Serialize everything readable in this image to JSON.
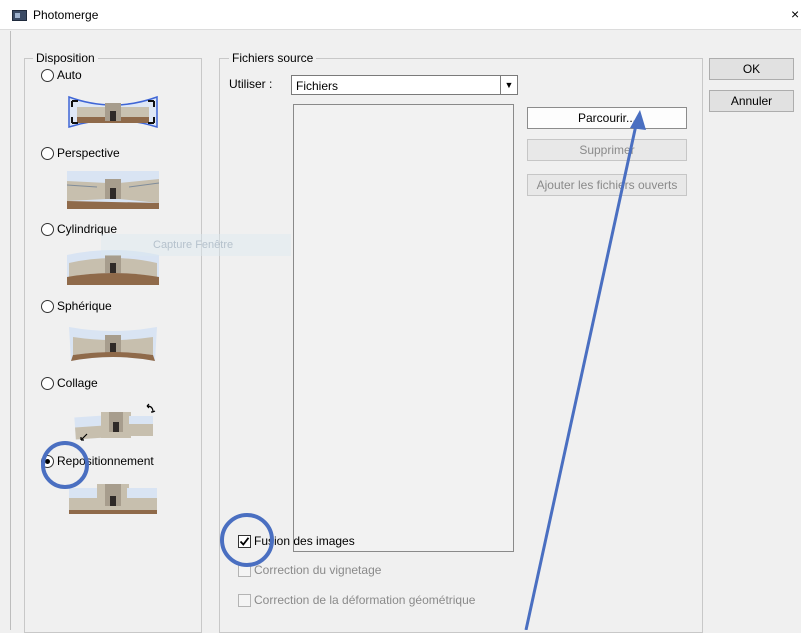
{
  "window": {
    "title": "Photomerge",
    "close_glyph": "×"
  },
  "layout_group": {
    "legend": "Disposition",
    "options": [
      {
        "label": "Auto",
        "checked": false
      },
      {
        "label": "Perspective",
        "checked": false
      },
      {
        "label": "Cylindrique",
        "checked": false
      },
      {
        "label": "Sphérique",
        "checked": false
      },
      {
        "label": "Collage",
        "checked": false
      },
      {
        "label": "Repositionnement",
        "checked": true
      }
    ]
  },
  "source_group": {
    "legend": "Fichiers source",
    "use_label": "Utiliser :",
    "use_value": "Fichiers",
    "ghost_text": "Capture Fenêtre",
    "buttons": {
      "browse": "Parcourir...",
      "remove": "Supprimer",
      "add_open": "Ajouter les fichiers ouverts"
    },
    "checkboxes": [
      {
        "label": "Fusion des images",
        "checked": true,
        "enabled": true
      },
      {
        "label": "Correction du vignetage",
        "checked": false,
        "enabled": false
      },
      {
        "label": "Correction de la déformation géométrique",
        "checked": false,
        "enabled": false
      }
    ]
  },
  "dialog_buttons": {
    "ok": "OK",
    "cancel": "Annuler"
  },
  "annotation": {
    "color": "#4a6fc1"
  },
  "icons": [
    "photoshop-app-icon",
    "close-icon",
    "dropdown-arrow-icon",
    "checkmark-icon"
  ]
}
